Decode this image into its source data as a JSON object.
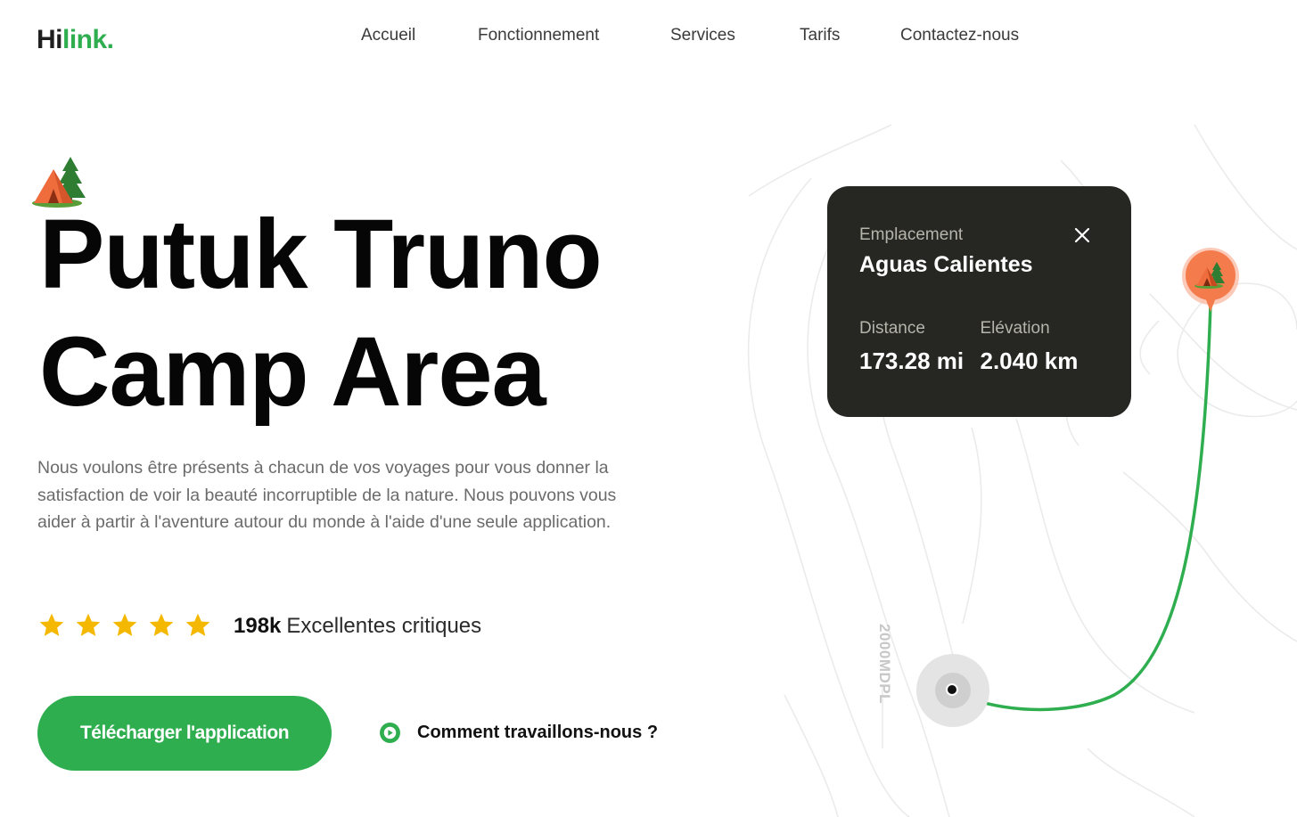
{
  "brand": {
    "logo_part1": "Hi",
    "logo_part2": "link."
  },
  "nav": {
    "items": [
      "Accueil",
      "Fonctionnement",
      "Services",
      "Tarifs",
      "Contactez-nous"
    ]
  },
  "hero": {
    "title_line1": "Putuk Truno",
    "title_line2": "Camp Area",
    "description": "Nous voulons être présents à chacun de vos voyages pour vous donner la satisfaction de voir la beauté incorruptible de la nature. Nous pouvons vous aider à partir à l'aventure autour du monde à l'aide d'une seule application.",
    "rating_stars": 5,
    "review_count": "198k",
    "review_text": "Excellentes critiques",
    "download_button": "Télécharger l'application",
    "how_link": "Comment travaillons-nous ?"
  },
  "location_card": {
    "location_label": "Emplacement",
    "location_name": "Aguas Calientes",
    "distance_label": "Distance",
    "distance_value": "173.28 mi",
    "elevation_label": "Elévation",
    "elevation_value": "2.040 km"
  },
  "map": {
    "altitude_label": "2000MDPL"
  },
  "colors": {
    "accent": "#2fae50",
    "card_bg": "#262622",
    "pin": "#f47c4c",
    "star": "#f5b800"
  },
  "icons": [
    "tent-icon",
    "close-icon",
    "star-icon",
    "play-icon",
    "location-pin-icon"
  ]
}
